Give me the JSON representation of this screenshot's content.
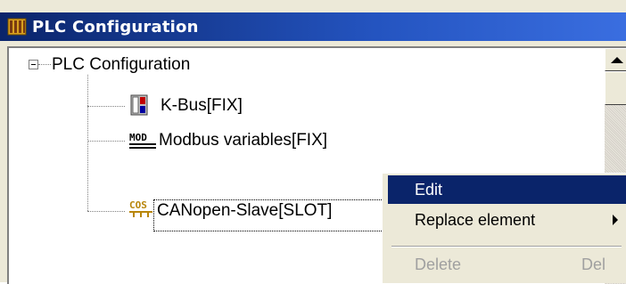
{
  "window": {
    "title": "PLC Configuration",
    "icon": "plc-config-icon"
  },
  "tree": {
    "root": {
      "label": "PLC Configuration",
      "expanded": true
    },
    "children": [
      {
        "label": "K-Bus[FIX]",
        "icon": "kbus-module-icon"
      },
      {
        "label": "Modbus variables[FIX]",
        "icon": "modbus-icon"
      },
      {
        "label": "CANopen-Slave[SLOT]",
        "icon": "canopen-cos-icon",
        "selected": true
      }
    ]
  },
  "context_menu": {
    "items": [
      {
        "label": "Edit",
        "highlighted": true
      },
      {
        "label": "Replace element",
        "has_submenu": true
      },
      {
        "label": "Delete",
        "shortcut": "Del",
        "disabled": true
      }
    ]
  },
  "colors": {
    "titlebar": "#0a246a",
    "menu_highlight": "#0a246a",
    "cos_icon": "#b8860b"
  }
}
